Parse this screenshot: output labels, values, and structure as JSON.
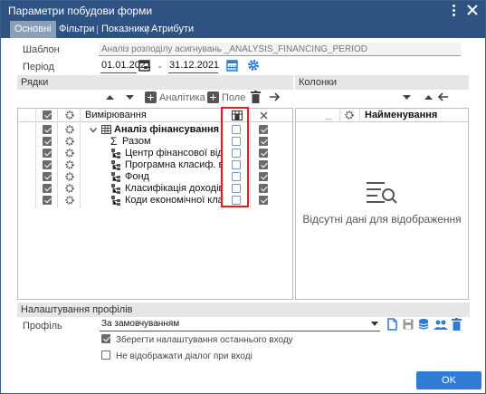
{
  "window": {
    "title": "Параметри побудови форми"
  },
  "tabs": [
    "Основні",
    "Фільтри",
    "Показники",
    "Атрибути"
  ],
  "template": {
    "label": "Шаблон",
    "value": "Аналіз розподілу асигнувань _ANALYSIS_FINANCING_PERIOD"
  },
  "period": {
    "label": "Період",
    "from": "01.01.2021",
    "dash": "-",
    "to": "31.12.2021"
  },
  "rows_section": {
    "header": "Рядки",
    "analytics_label": "Аналітика",
    "field_label": "Поле",
    "col_header": "Вимірювання",
    "items": [
      {
        "text": "Аналіз фінансування за пер",
        "bold": true,
        "check1": true,
        "check2": false,
        "check3": true
      },
      {
        "text": "Разом",
        "bold": false,
        "check1": true,
        "check2": false,
        "check3": true
      },
      {
        "text": "Центр фінансової відповід",
        "bold": false,
        "check1": true,
        "check2": false,
        "check3": true
      },
      {
        "text": "Програмна класиф. видат",
        "bold": false,
        "check1": true,
        "check2": false,
        "check3": true
      },
      {
        "text": "Фонд",
        "bold": false,
        "check1": true,
        "check2": false,
        "check3": true
      },
      {
        "text": "Класифікація доходів бюд",
        "bold": false,
        "check1": true,
        "check2": false,
        "check3": true
      },
      {
        "text": "Коди економічної класиф",
        "bold": false,
        "check1": true,
        "check2": false,
        "check3": true
      }
    ]
  },
  "columns_section": {
    "header": "Колонки",
    "col_dots": "...",
    "col_header": "Найменування",
    "empty_text": "Відсутні дані для відображення"
  },
  "profile_section": {
    "header": "Налаштування профілів",
    "label": "Профіль",
    "value": "За замовчуванням",
    "save_last": "Зберегти налаштування останнього входу",
    "save_last_checked": true,
    "no_dialog": "Не відображати діалог при вході",
    "no_dialog_checked": false
  },
  "ok_label": "OK",
  "colors": {
    "titlebar": "#2e5382",
    "accent": "#2f7bd6",
    "highlight": "#e02020"
  }
}
